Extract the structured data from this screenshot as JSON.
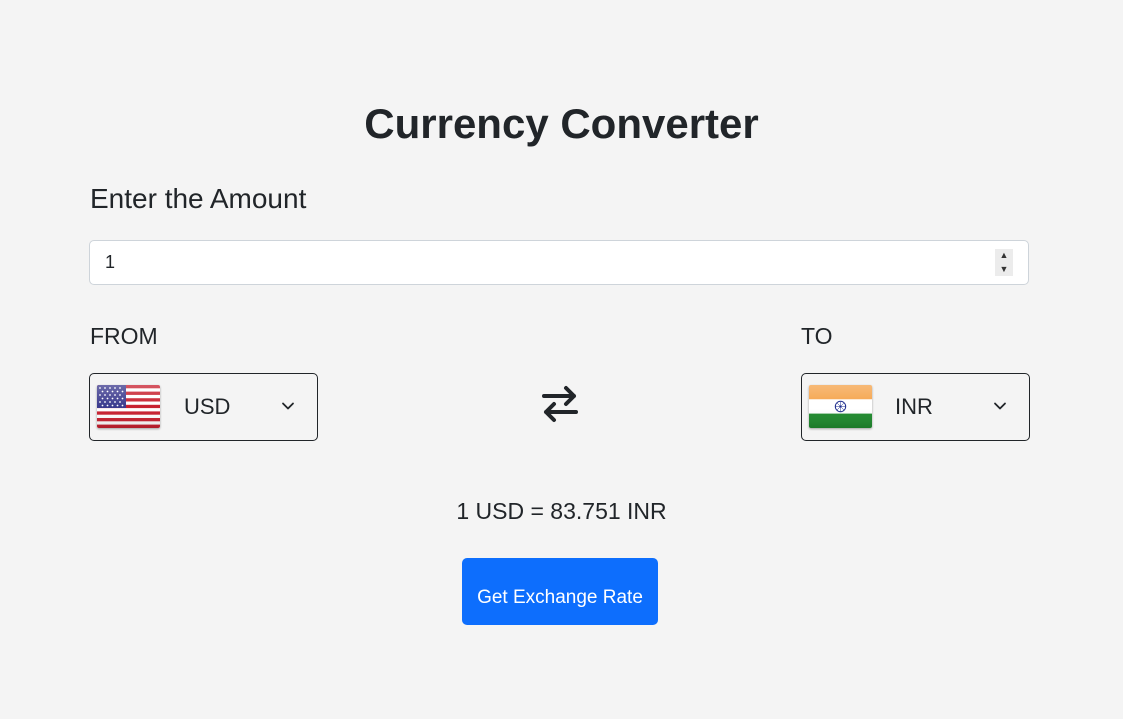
{
  "title": "Currency Converter",
  "amount": {
    "label": "Enter the Amount",
    "value": "1"
  },
  "from": {
    "label": "FROM",
    "currency": "USD",
    "flag_icon": "us-flag-icon"
  },
  "to": {
    "label": "TO",
    "currency": "INR",
    "flag_icon": "india-flag-icon"
  },
  "swap_icon": "swap-arrows-icon",
  "result": {
    "text": "1 USD = 83.751 INR"
  },
  "button": {
    "label": "Get Exchange Rate",
    "color": "#0d6efd"
  },
  "colors": {
    "background": "#f4f4f4",
    "text": "#212529",
    "accent": "#0d6efd"
  }
}
